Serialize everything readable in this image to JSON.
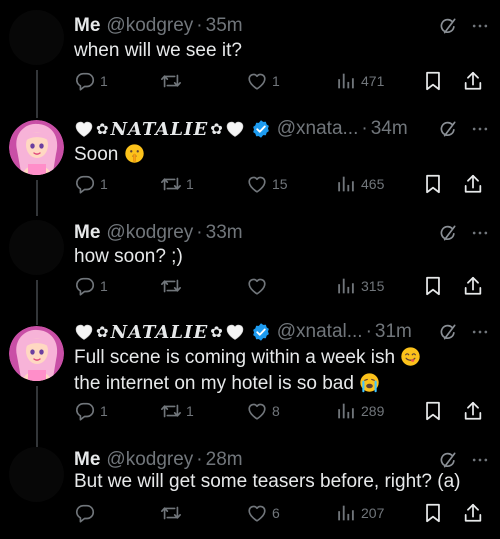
{
  "posts": [
    {
      "author": "Me",
      "handle": "@kodgrey",
      "time": "35m",
      "text": "when will we see it?",
      "replies": "1",
      "reposts": "",
      "likes": "1",
      "views": "471"
    },
    {
      "author": "NATALIE",
      "handle": "@xnata...",
      "time": "34m",
      "text": "Soon",
      "replies": "1",
      "reposts": "1",
      "likes": "15",
      "views": "465"
    },
    {
      "author": "Me",
      "handle": "@kodgrey",
      "time": "33m",
      "text": "how soon? ;)",
      "replies": "1",
      "reposts": "",
      "likes": "",
      "views": "315"
    },
    {
      "author": "NATALIE",
      "handle": "@xnatal...",
      "time": "31m",
      "text_part1": "Full scene is coming within a week ish",
      "text_part2": " the internet on my hotel is so bad",
      "replies": "1",
      "reposts": "1",
      "likes": "8",
      "views": "289"
    },
    {
      "author": "Me",
      "handle": "@kodgrey",
      "time": "28m",
      "text": "But we will get some teasers before, right? (a)",
      "replies": "",
      "reposts": "",
      "likes": "6",
      "views": "207"
    }
  ],
  "separator": "·",
  "colors": {
    "background": "#000000",
    "text": "#e7e9ea",
    "secondary": "#71767b",
    "verified": "#1d9bf0",
    "thread_line": "#333639"
  },
  "icons": [
    "reply-icon",
    "repost-icon",
    "like-icon",
    "views-icon",
    "bookmark-icon",
    "share-icon",
    "grok-icon",
    "more-icon",
    "verified-badge-icon",
    "white-heart-emoji",
    "shushing-face-emoji",
    "yum-face-emoji",
    "crying-face-emoji"
  ]
}
